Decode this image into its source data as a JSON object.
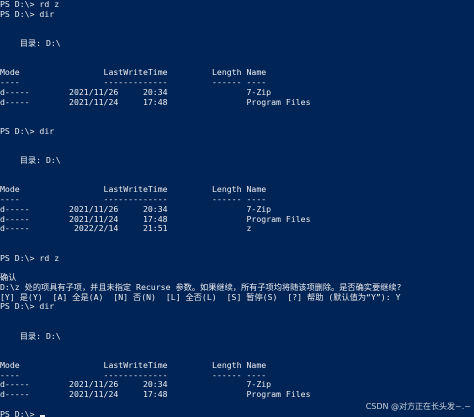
{
  "console": {
    "lines": [
      "PS D:\\> rd z",
      "PS D:\\> dir",
      "",
      "",
      "    目录: D:\\",
      "",
      "",
      "Mode                 LastWriteTime         Length Name",
      "----                 -------------         ------ ----",
      "d-----        2021/11/26     20:34                7-Zip",
      "d-----        2021/11/24     17:48                Program Files",
      "",
      "",
      "PS D:\\> dir",
      "",
      "",
      "    目录: D:\\",
      "",
      "",
      "Mode                 LastWriteTime         Length Name",
      "----                 -------------         ------ ----",
      "d-----        2021/11/26     20:34                7-Zip",
      "d-----        2021/11/24     17:48                Program Files",
      "d-----         2022/2/14     21:51                z",
      "",
      "",
      "PS D:\\> rd z",
      "",
      "确认",
      "D:\\z 处的项具有子项，并且未指定 Recurse 参数。如果继续，所有子项均将随该项删除。是否确实要继续?",
      "[Y] 是(Y)  [A] 全是(A)  [N] 否(N)  [L] 全否(L)  [S] 暂停(S)  [?] 帮助 (默认值为“Y”): Y",
      "PS D:\\> dir",
      "",
      "",
      "    目录: D:\\",
      "",
      "",
      "Mode                 LastWriteTime         Length Name",
      "----                 -------------         ------ ----",
      "d-----        2021/11/26     20:34                7-Zip",
      "d-----        2021/11/24     17:48                Program Files",
      ""
    ],
    "prompt": "PS D:\\> "
  },
  "watermark": "CSDN @对方正在长头发~.~",
  "colors": {
    "background": "#012456",
    "text": "#eeedf0"
  }
}
